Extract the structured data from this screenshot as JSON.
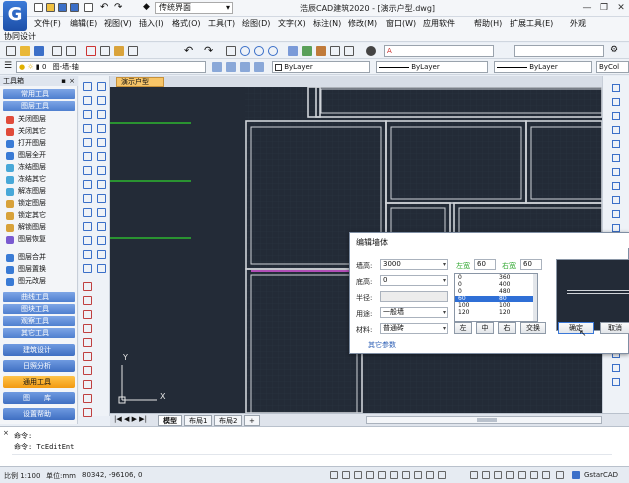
{
  "app": {
    "ui_mode": "传统界面",
    "window_title": "浩辰CAD建筑2020 - [演示户型.dwg]",
    "logo_letter": "G"
  },
  "menu": [
    "文件(F)",
    "编辑(E)",
    "视图(V)",
    "插入(I)",
    "格式(O)",
    "工具(T)",
    "绘图(D)",
    "文字(X)",
    "标注(N)",
    "修改(M)",
    "窗口(W)",
    "应用软件",
    "帮助(H)",
    "扩展工具(E)",
    "外观"
  ],
  "coop": {
    "label": "协同设计"
  },
  "toolbar": {
    "layer_combo": "0",
    "layer_state": "图-墙-轴",
    "color_combo": "ByLayer",
    "linetype_combo": "ByLayer",
    "lineweight_combo": "ByLayer",
    "plotstyle_combo": "ByCol"
  },
  "toolbox": {
    "header": "工具箱",
    "close_label": "×",
    "groups": [
      {
        "label": "常用工具"
      },
      {
        "label": "图层工具"
      }
    ],
    "layer_items": [
      "关闭图层",
      "关闭其它",
      "打开图层",
      "图层全开",
      "冻结图层",
      "冻结其它",
      "解冻图层",
      "锁定图层",
      "锁定其它",
      "解锁图层",
      "图层恢复"
    ],
    "layer_items_2": [
      "图层合并",
      "图层置换",
      "图元改层"
    ],
    "groups_2": [
      {
        "label": "曲线工具"
      },
      {
        "label": "图块工具"
      },
      {
        "label": "观察工具"
      },
      {
        "label": "其它工具"
      }
    ],
    "categories": [
      {
        "label": "建筑设计",
        "active": false
      },
      {
        "label": "日照分析",
        "active": false
      },
      {
        "label": "通用工具",
        "active": true
      },
      {
        "label": "图　　库",
        "active": false
      },
      {
        "label": "设置帮助",
        "active": false
      }
    ]
  },
  "drawing": {
    "doc_tab": "演示户型",
    "axis_x": "X",
    "axis_y": "Y"
  },
  "layout_tabs": {
    "items": [
      {
        "label": "模型",
        "active": true
      },
      {
        "label": "布局1",
        "active": false
      },
      {
        "label": "布局2",
        "active": false
      },
      {
        "label": "+",
        "active": false
      }
    ]
  },
  "command": {
    "lines": [
      "命令:",
      "命令: TcEditEnt"
    ]
  },
  "status": {
    "scale": "比例 1:100",
    "unit": "单位:mm",
    "coords": "80342, -96106, 0",
    "brand": "GstarCAD"
  },
  "dialog": {
    "title": "编辑墙体",
    "close_label": "×",
    "fields": {
      "height_label": "墙高:",
      "height_value": "3000",
      "base_label": "底高:",
      "base_value": "0",
      "radius_label": "半径:",
      "radius_value": "",
      "usage_label": "用途:",
      "usage_value": "一般墙",
      "material_label": "材料:",
      "material_value": "普通砖"
    },
    "left_width_label": "左宽",
    "left_width_value": "60",
    "right_width_label": "右宽",
    "right_width_value": "60",
    "list": [
      {
        "a": "0",
        "b": "360",
        "selected": false
      },
      {
        "a": "0",
        "b": "400",
        "selected": false
      },
      {
        "a": "0",
        "b": "480",
        "selected": false
      },
      {
        "a": "60",
        "b": "80",
        "selected": true
      },
      {
        "a": "100",
        "b": "100",
        "selected": false
      },
      {
        "a": "120",
        "b": "120",
        "selected": false
      }
    ],
    "buttons": {
      "left": "左",
      "center": "中",
      "right": "右",
      "swap": "交换",
      "ok": "确定",
      "cancel": "取消"
    },
    "more_params": "其它参数"
  },
  "colors": {
    "canvas": "#232b37",
    "wall": "#cfd3d8",
    "green_line": "#2ed12e",
    "magenta_line": "#e05ae0",
    "accent": "#2f6fd6"
  }
}
